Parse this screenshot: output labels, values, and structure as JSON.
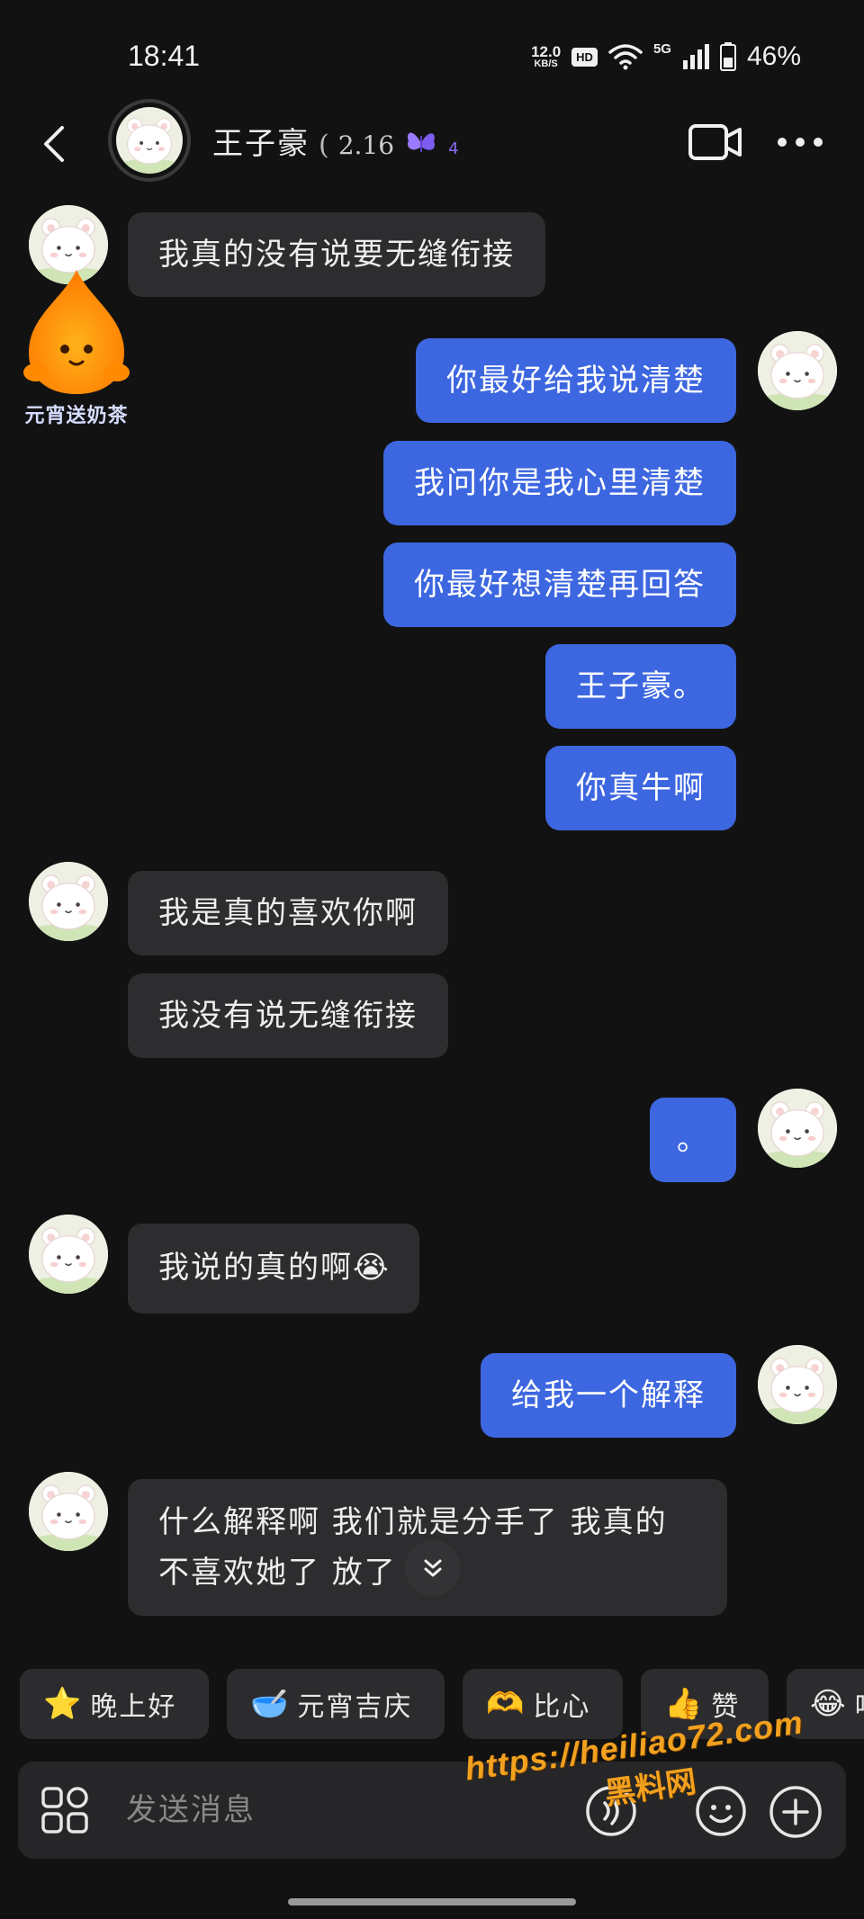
{
  "status_bar": {
    "time": "18:41",
    "net_speed_value": "12.0",
    "net_speed_unit": "KB/S",
    "hd": "HD",
    "network": "5G",
    "battery": "46%"
  },
  "header": {
    "contact_name": "王子豪",
    "paren": "(",
    "score": "2.16",
    "level": "4"
  },
  "promo": {
    "label": "元宵送奶茶"
  },
  "messages": [
    {
      "side": "in",
      "text": "我真的没有说要无缝衔接"
    },
    {
      "side": "out",
      "text": "你最好给我说清楚"
    },
    {
      "side": "out",
      "text": "我问你是我心里清楚"
    },
    {
      "side": "out",
      "text": "你最好想清楚再回答"
    },
    {
      "side": "out",
      "text": "王子豪。"
    },
    {
      "side": "out",
      "text": "你真牛啊"
    },
    {
      "side": "in",
      "text": "我是真的喜欢你啊"
    },
    {
      "side": "in",
      "text": "我没有说无缝衔接"
    },
    {
      "side": "out",
      "text": "。"
    },
    {
      "side": "in",
      "text": "我说的真的啊",
      "emoji": "😭"
    },
    {
      "side": "out",
      "text": "给我一个解释"
    },
    {
      "side": "in",
      "text_line1": "什么解释啊 我们就是分手了 我真的",
      "text_line2": "不喜欢她了 放了"
    }
  ],
  "quick_replies": [
    {
      "icon": "⭐",
      "label": "晚上好"
    },
    {
      "icon": "🥣",
      "label": "元宵吉庆"
    },
    {
      "icon": "🫶",
      "label": "比心"
    },
    {
      "icon": "👍",
      "label": "赞"
    },
    {
      "icon": "😂",
      "label": "哈"
    }
  ],
  "input": {
    "placeholder": "发送消息"
  },
  "watermark": {
    "url": "https://heiliao72.com",
    "site_name": "黑料网"
  },
  "colors": {
    "background": "#121212",
    "incoming_bubble": "#2d2d2f",
    "outgoing_bubble": "#3d67e0",
    "watermark": "#f2a11f"
  }
}
